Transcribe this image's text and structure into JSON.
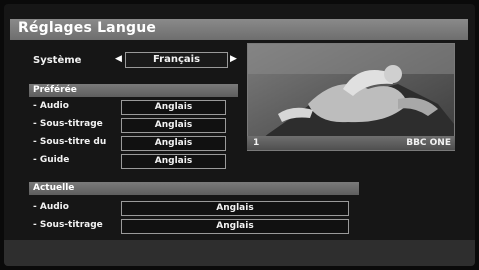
{
  "header": {
    "title": "Réglages Langue"
  },
  "system": {
    "label": "Système",
    "value": "Français"
  },
  "preferred": {
    "section_label": "Préférée",
    "rows": [
      {
        "label": "- Audio",
        "value": "Anglais"
      },
      {
        "label": "- Sous-titrage",
        "value": "Anglais"
      },
      {
        "label": "- Sous-titre du",
        "value": "Anglais"
      },
      {
        "label": "- Guide",
        "value": "Anglais"
      }
    ]
  },
  "current": {
    "section_label": "Actuelle",
    "rows": [
      {
        "label": "- Audio",
        "value": "Anglais"
      },
      {
        "label": "- Sous-titrage",
        "value": "Anglais"
      }
    ]
  },
  "preview": {
    "channel_number": "1",
    "channel_name": "BBC ONE"
  },
  "icons": {
    "left": "arrow-left-icon",
    "right": "arrow-right-icon"
  }
}
